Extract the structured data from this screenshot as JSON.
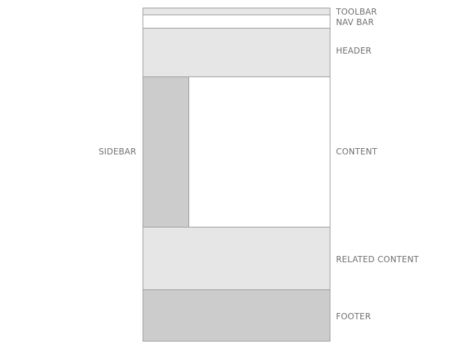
{
  "labels": {
    "toolbar": "TOOLBAR",
    "nav_bar": "NAV BAR",
    "header": "HEADER",
    "sidebar": "SIDEBAR",
    "content": "CONTENT",
    "related_content": "RELATED CONTENT",
    "footer": "FOOTER"
  },
  "colors": {
    "light_gray": "#e6e6e6",
    "mid_gray": "#cccccc",
    "white": "#ffffff",
    "border": "#9a9a9a",
    "label_text": "#6f6f6f"
  }
}
